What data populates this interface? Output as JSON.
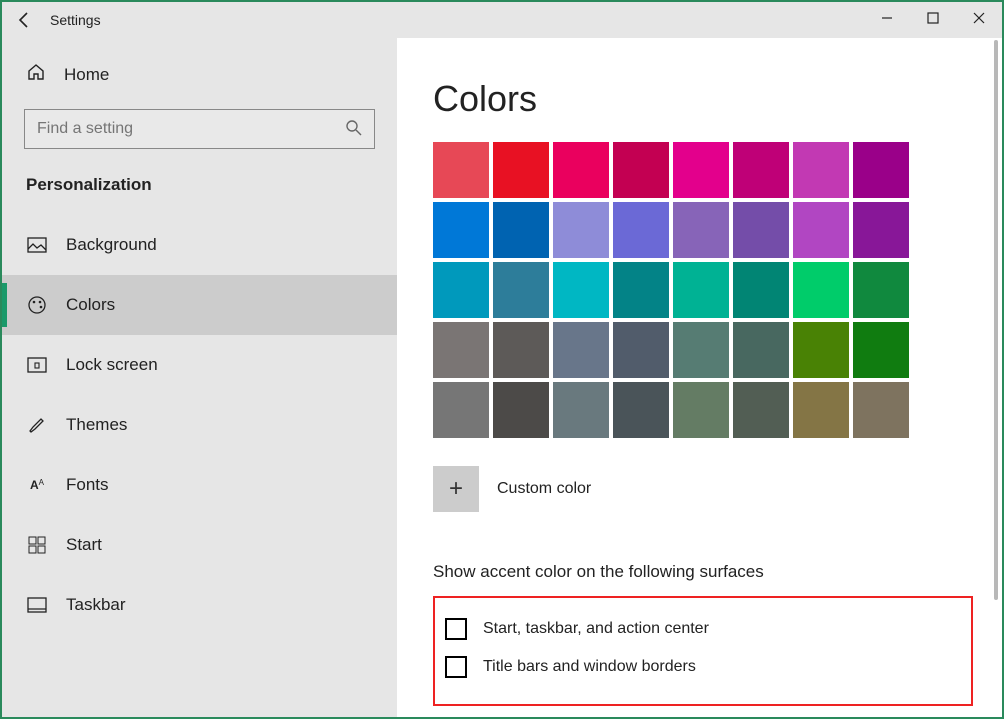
{
  "window": {
    "title": "Settings"
  },
  "sidebar": {
    "home": "Home",
    "search_placeholder": "Find a setting",
    "group": "Personalization",
    "items": [
      {
        "label": "Background"
      },
      {
        "label": "Colors"
      },
      {
        "label": "Lock screen"
      },
      {
        "label": "Themes"
      },
      {
        "label": "Fonts"
      },
      {
        "label": "Start"
      },
      {
        "label": "Taskbar"
      }
    ]
  },
  "content": {
    "title": "Colors",
    "swatches": [
      "#e74856",
      "#e81123",
      "#ea005e",
      "#c30052",
      "#e3008c",
      "#bf0077",
      "#c239b3",
      "#9a0089",
      "#0078d7",
      "#0063b1",
      "#8e8cd8",
      "#6b69d6",
      "#8764b8",
      "#744da9",
      "#b146c2",
      "#881798",
      "#0099bc",
      "#2d7d9a",
      "#00b7c3",
      "#038387",
      "#00b294",
      "#018574",
      "#00cc6a",
      "#10893e",
      "#7a7574",
      "#5d5a58",
      "#68768a",
      "#515c6b",
      "#567c73",
      "#486860",
      "#498205",
      "#107c10",
      "#767676",
      "#4c4a48",
      "#69797e",
      "#4a5459",
      "#647c64",
      "#525e54",
      "#847545",
      "#7e735f"
    ],
    "custom_label": "Custom color",
    "accent_label": "Show accent color on the following surfaces",
    "checks": [
      "Start, taskbar, and action center",
      "Title bars and window borders"
    ]
  }
}
